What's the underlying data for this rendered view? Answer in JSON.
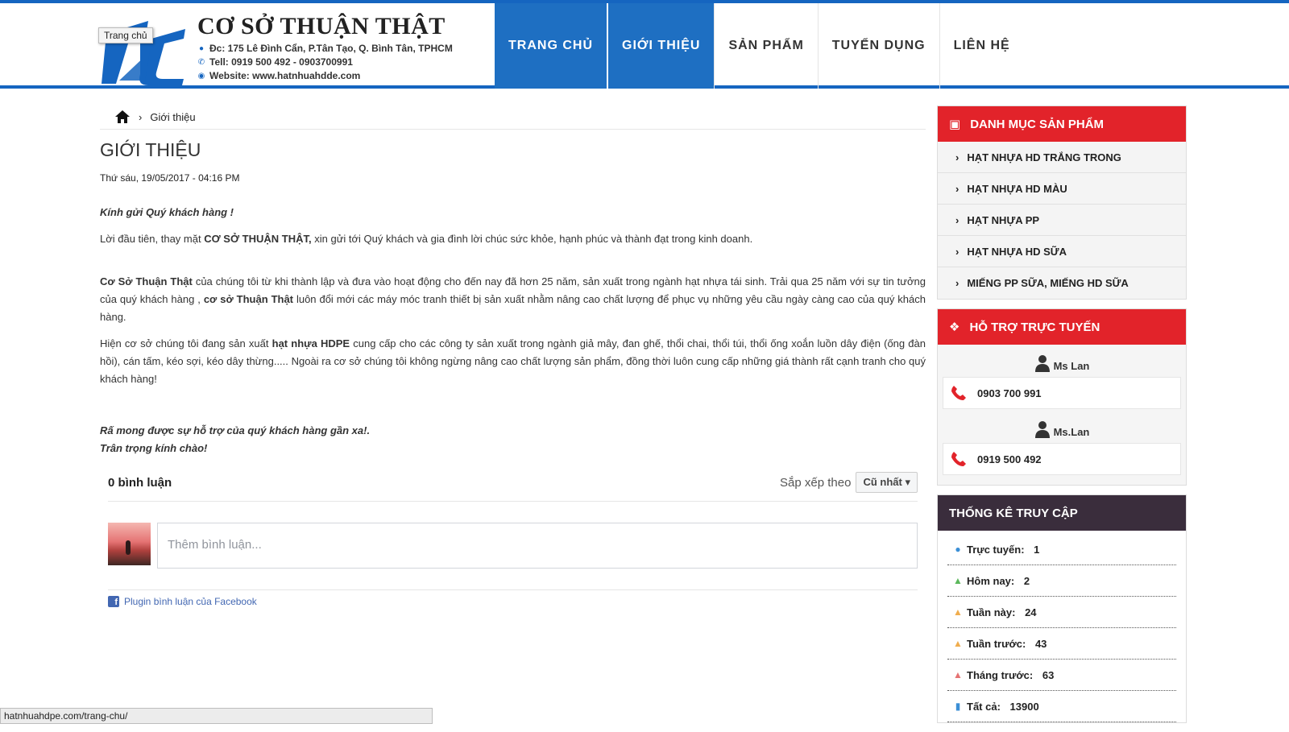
{
  "header": {
    "tooltip": "Trang chủ",
    "company_name": "CƠ SỞ THUẬN THẬT",
    "address": "Đc: 175 Lê Đình Cẩn, P.Tân Tạo, Q. Bình Tân, TPHCM",
    "phone": "Tell: 0919 500 492 - 0903700991",
    "website": "Website: www.hatnhuahdde.com"
  },
  "nav": [
    {
      "label": "TRANG CHỦ"
    },
    {
      "label": "GIỚI THIỆU"
    },
    {
      "label": "SẢN PHẨM"
    },
    {
      "label": "TUYỂN DỤNG"
    },
    {
      "label": "LIÊN HỆ"
    }
  ],
  "breadcrumb": {
    "current": "Giới thiệu"
  },
  "article": {
    "title": "GIỚI THIỆU",
    "date": "Thứ sáu, 19/05/2017 - 04:16 PM",
    "greeting": "Kính gửi Quý khách hàng !",
    "p2_a": "Lời đầu tiên, thay mặt ",
    "p2_b": "CƠ SỞ THUẬN THẬT,",
    "p2_c": " xin gửi tới Quý khách và gia đình lời chúc sức khỏe, hạnh phúc và thành đạt trong kinh doanh.",
    "p3_a": "Cơ Sở Thuận Thật",
    "p3_b": " của chúng tôi từ khi thành lập và đưa vào hoạt động cho đến nay đã hơn 25 năm, sản xuất trong ngành hạt nhựa tái sinh. Trải qua 25 năm với sự tin tưởng của quý khách hàng , ",
    "p3_c": "cơ sở Thuận Thật",
    "p3_d": " luôn đổi mới các máy móc tranh thiết bị sản xuất nhằm nâng cao chất lượng để phục vụ những yêu cầu ngày càng cao của quý khách hàng.",
    "p4_a": "Hiện cơ sở chúng tôi đang sản xuất ",
    "p4_b": "hạt nhựa HDPE",
    "p4_c": " cung cấp cho các công ty sản xuất trong ngành giả mây, đan ghế, thổi chai, thổi túi, thổi ống xoắn luồn dây điện (ống đàn hồi), cán tấm, kéo sợi, kéo dây thừng..... Ngoài ra cơ sở chúng tôi không ngừng nâng cao chất lượng sản phẩm, đồng thời luôn cung cấp những giá thành rất cạnh tranh cho quý khách hàng!",
    "closing1": "Rấ mong được sự hỗ trợ của quý khách hàng gần xa!.",
    "closing2": "Trân trọng kính chào!"
  },
  "comments": {
    "count": "0 bình luận",
    "sort_label": "Sắp xếp theo",
    "sort_value": "Cũ nhất",
    "placeholder": "Thêm bình luận...",
    "plugin": "Plugin bình luận của Facebook"
  },
  "sidebar": {
    "categories_title": "DANH MỤC SẢN PHẨM",
    "categories": [
      "HẠT NHỰA HD TRẮNG TRONG",
      "HẠT NHỰA HD MÀU",
      "HẠT NHỰA PP",
      "HẠT NHỰA HD SỮA",
      "MIẾNG PP SỮA, MIẾNG HD SỮA"
    ],
    "support_title": "HỖ TRỢ TRỰC TUYẾN",
    "support": [
      {
        "name": "Ms Lan",
        "phone": "0903 700 991"
      },
      {
        "name": "Ms.Lan",
        "phone": "0919 500 492"
      }
    ],
    "stats_title": "THỐNG KÊ TRUY CẬP",
    "stats": [
      {
        "label": "Trực tuyến:",
        "value": "1",
        "color": "#3b8fd6"
      },
      {
        "label": "Hôm nay:",
        "value": "2",
        "color": "#5cb85c"
      },
      {
        "label": "Tuần này:",
        "value": "24",
        "color": "#f0ad4e"
      },
      {
        "label": "Tuần trước:",
        "value": "43",
        "color": "#f0ad4e"
      },
      {
        "label": "Tháng trước:",
        "value": "63",
        "color": "#e57373"
      },
      {
        "label": "Tất cả:",
        "value": "13900",
        "color": "#3b8fd6"
      }
    ]
  },
  "statusbar": {
    "url": "hatnhuahdpe.com/trang-chu/"
  },
  "colors": {
    "brand_blue": "#1e6fc2",
    "brand_red": "#e2232a",
    "dark_header": "#3a2d3c"
  }
}
